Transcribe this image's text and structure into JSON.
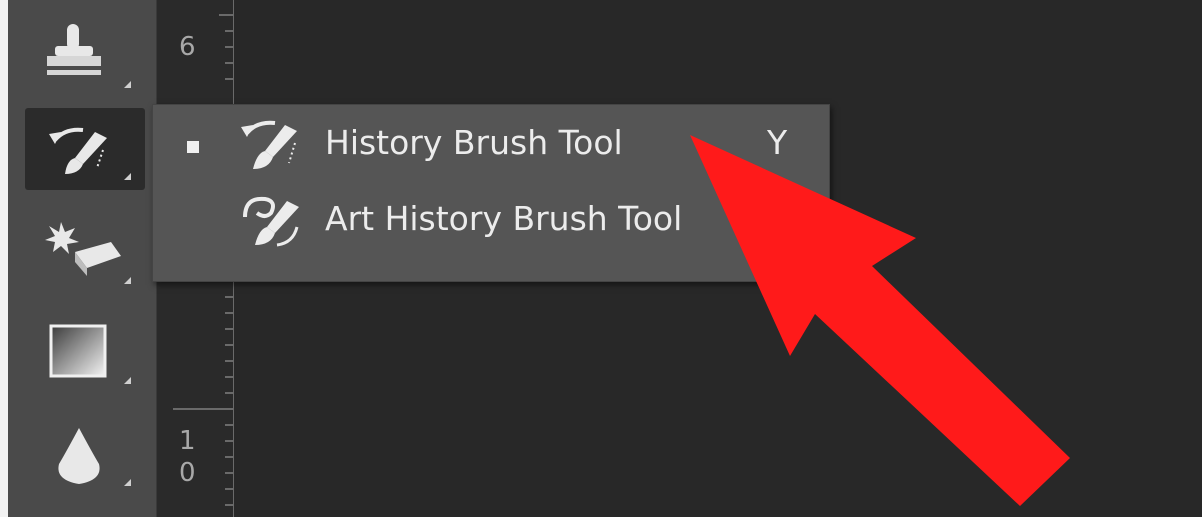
{
  "toolbar": {
    "tools": [
      {
        "name": "clone-stamp",
        "icon": "stamp-icon"
      },
      {
        "name": "history-brush",
        "icon": "history-brush-icon",
        "active": true
      },
      {
        "name": "eraser",
        "icon": "eraser-icon"
      },
      {
        "name": "gradient",
        "icon": "gradient-icon"
      },
      {
        "name": "blur",
        "icon": "drop-icon"
      }
    ]
  },
  "ruler": {
    "labels": [
      "6",
      "1",
      "0"
    ]
  },
  "flyout_menu": {
    "items": [
      {
        "label": "History Brush Tool",
        "shortcut": "Y",
        "selected": true,
        "icon": "history-brush-icon"
      },
      {
        "label": "Art History Brush Tool",
        "shortcut": "",
        "selected": false,
        "icon": "art-history-brush-icon"
      }
    ]
  },
  "annotation": {
    "color": "#ff1a1a",
    "shape": "arrow-pointing-to-menu-item"
  },
  "colors": {
    "toolbar_bg": "#4a4a4a",
    "menu_bg": "#555555",
    "canvas_bg": "#282828",
    "text": "#ececec"
  }
}
